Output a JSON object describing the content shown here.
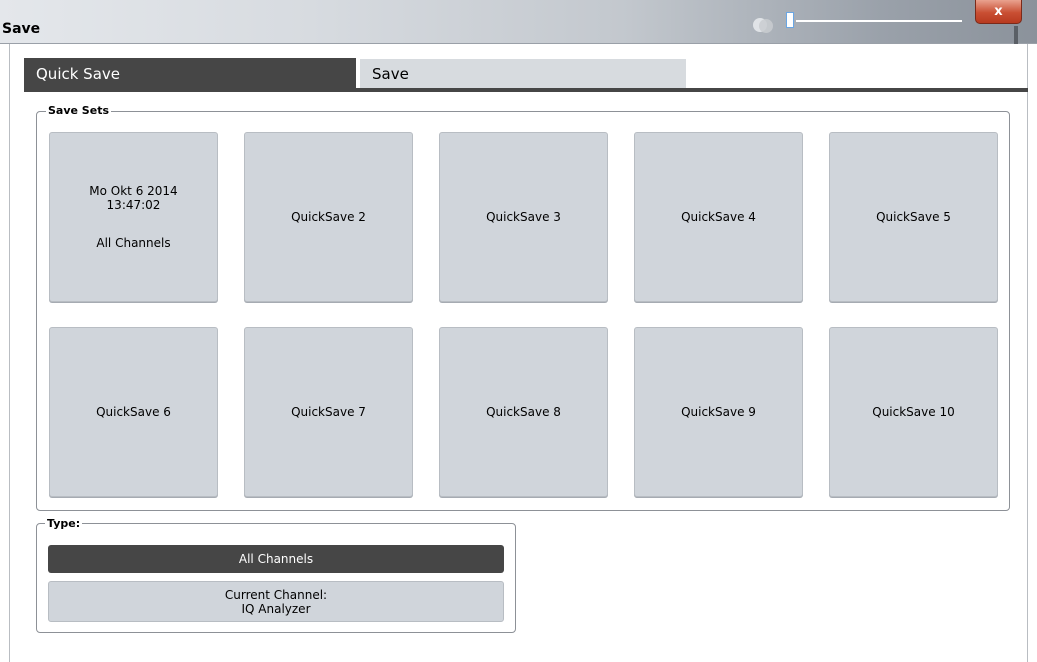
{
  "window": {
    "title": "Save",
    "close_label": "x"
  },
  "tabs": [
    {
      "label": "Quick Save",
      "active": true
    },
    {
      "label": "Save",
      "active": false
    }
  ],
  "save_sets": {
    "label": "Save Sets",
    "slot1": {
      "date": "Mo Okt 6 2014",
      "time": "13:47:02",
      "type": "All Channels"
    },
    "slots": [
      "QuickSave 2",
      "QuickSave 3",
      "QuickSave 4",
      "QuickSave 5",
      "QuickSave 6",
      "QuickSave 7",
      "QuickSave 8",
      "QuickSave 9",
      "QuickSave 10"
    ]
  },
  "type": {
    "label": "Type:",
    "all_channels": "All Channels",
    "current_channel_line1": "Current Channel:",
    "current_channel_line2": "IQ Analyzer"
  },
  "colors": {
    "active_dark": "#464646",
    "tile_bg": "#d0d5db",
    "close_red": "#c94f33"
  },
  "icons": {
    "ghost": "two-overlapping-circles-icon",
    "close": "close-icon"
  }
}
